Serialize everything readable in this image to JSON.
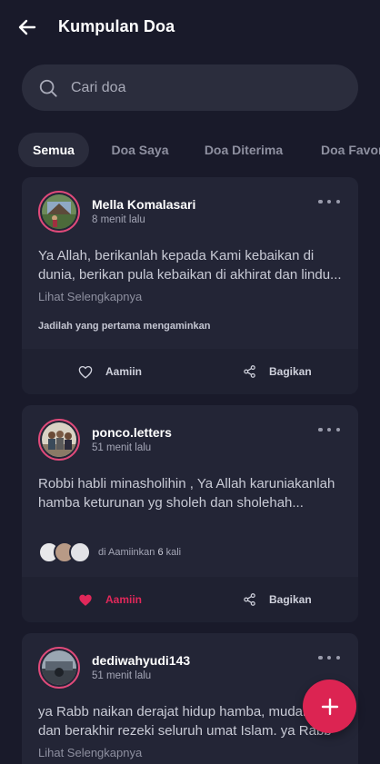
{
  "header": {
    "title": "Kumpulan Doa"
  },
  "search": {
    "placeholder": "Cari doa"
  },
  "tabs": [
    {
      "label": "Semua",
      "active": true
    },
    {
      "label": "Doa Saya",
      "active": false
    },
    {
      "label": "Doa Diterima",
      "active": false
    },
    {
      "label": "Doa Favorit",
      "active": false
    }
  ],
  "posts": [
    {
      "username": "Mella Komalasari",
      "time": "8 menit lalu",
      "text": "Ya Allah, berikanlah kepada Kami kebaikan di dunia, berikan pula kebaikan di akhirat dan lindu...",
      "see_more": "Lihat Selengkapnya",
      "amen_note": "Jadilah yang pertama mengaminkan",
      "amin_label": "Aamiin",
      "share_label": "Bagikan",
      "liked": false
    },
    {
      "username": "ponco.letters",
      "time": "51 menit lalu",
      "text": "Robbi habli minasholihin , Ya Allah karuniakanlah hamba keturunan yg sholeh dan sholehah...",
      "amin_prefix": "di Aamiinkan",
      "amin_count": "6",
      "amin_suffix": "kali",
      "amin_label": "Aamiin",
      "share_label": "Bagikan",
      "liked": true
    },
    {
      "username": "dediwahyudi143",
      "time": "51 menit lalu",
      "text": "ya Rabb naikan derajat hidup hamba, mudahkan dan berakhir rezeki seluruh umat Islam. ya Rabb",
      "see_more": "Lihat Selengkapnya"
    }
  ],
  "colors": {
    "accent": "#dc2452",
    "background": "#191a2a",
    "card": "#232536"
  },
  "icons": {
    "back": "arrow-left-icon",
    "search": "search-icon",
    "more": "more-dots-icon",
    "like": "heart-icon",
    "share": "share-icon",
    "add": "plus-icon"
  }
}
